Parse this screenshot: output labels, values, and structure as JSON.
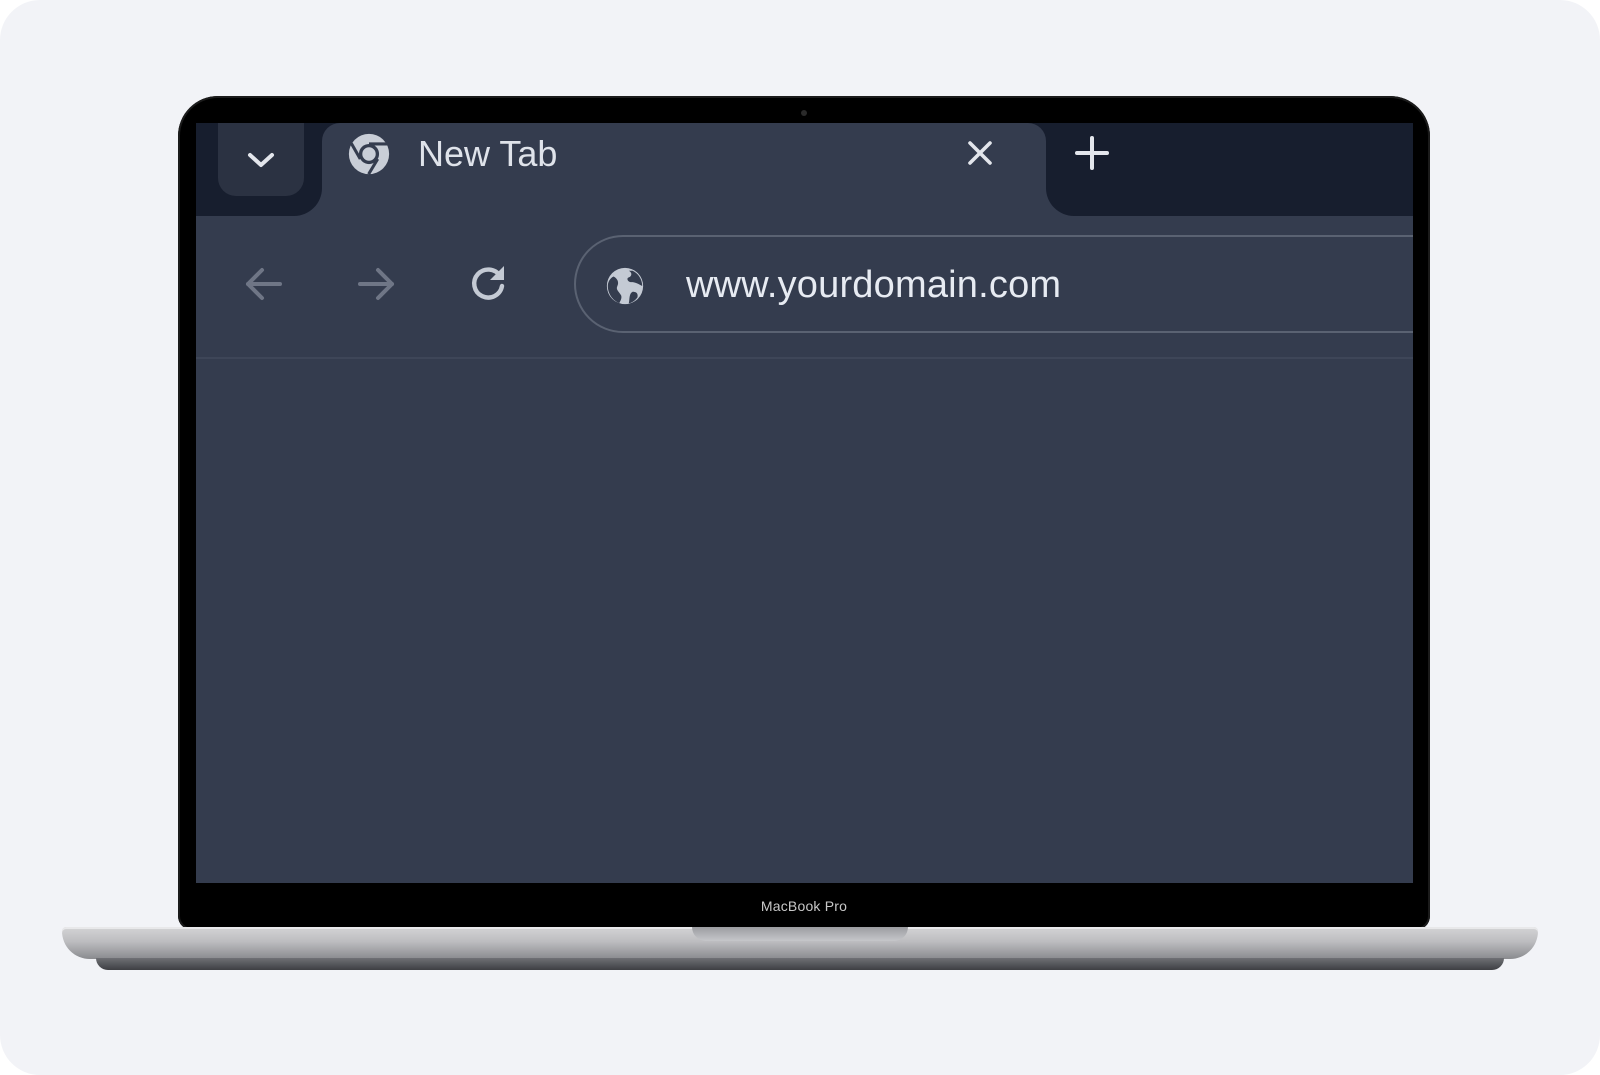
{
  "device": {
    "brand_label": "MacBook Pro"
  },
  "browser": {
    "tabs": [
      {
        "title": "New Tab",
        "favicon": "chrome-icon",
        "active": true
      }
    ],
    "toolbar": {
      "back_icon": "arrow-left-icon",
      "forward_icon": "arrow-right-icon",
      "reload_icon": "reload-icon"
    },
    "omnibox": {
      "url": "www.yourdomain.com",
      "site_icon": "globe-icon"
    }
  },
  "colors": {
    "page_bg": "#f2f3f7",
    "browser_bg": "#343c4e",
    "tabstrip_bg": "#171e2e",
    "text": "#e7ebf2"
  }
}
